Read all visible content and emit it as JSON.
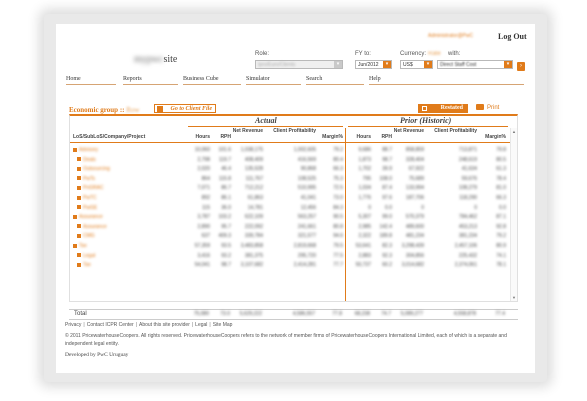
{
  "header": {
    "user_name": "Administrator@PwC",
    "logout_label": "Log Out",
    "site_name_blurred": "mypwc",
    "site_name_suffix": "site"
  },
  "filters": {
    "role_label": "Role:",
    "role_value": "Ipro/Euro/Clients",
    "fy_label": "FY to:",
    "fy_value": "Jun/2012",
    "currency_label": "Currency:",
    "currency_value": "US$",
    "with_blurred": "Rate",
    "with_label": "with:",
    "with_value": "Direct Staff Cost",
    "go_label": "›"
  },
  "menu": {
    "items": [
      "Home",
      "Reports",
      "Business Cube",
      "Simulator",
      "Search",
      "Help"
    ]
  },
  "section": {
    "title": "Economic group :: ",
    "title_blurred": "Row",
    "client_file_button": "Go to Client File",
    "restated_button": "Restated",
    "print_label": "Print"
  },
  "table": {
    "group_actual": "Actual",
    "group_prior": "Prior (Historic)",
    "columns_left": "LoS/SubLoS/Company/Project",
    "columns": [
      "Hours",
      "RPH",
      "Net Revenue",
      "Client Profitability",
      "Margin%",
      "Hours",
      "RPH",
      "Net Revenue",
      "Client Profitability",
      "Margin%"
    ],
    "rows": [
      {
        "name": "Advisory",
        "level": 0,
        "values": [
          "10,060",
          "101.6",
          "1,038,175",
          "1,002,605",
          "79.2",
          "9,686",
          "88.7",
          "858,859",
          "713,871",
          "79.8"
        ]
      },
      {
        "name": "Deals",
        "level": 1,
        "values": [
          "2,798",
          "119.7",
          "408,409",
          "416,569",
          "80.4",
          "1,873",
          "98.7",
          "328,404",
          "248,619",
          "80.5"
        ]
      },
      {
        "name": "Outsourcing",
        "level": 1,
        "values": [
          "2,020",
          "46.4",
          "135,528",
          "90,868",
          "66.3",
          "1,702",
          "39.9",
          "67,922",
          "41,634",
          "61.3"
        ]
      },
      {
        "name": "PwTs",
        "level": 1,
        "values": [
          "864",
          "115.8",
          "111,767",
          "108,525",
          "75.3",
          "795",
          "108.0",
          "75,689",
          "59,676",
          "78.4"
        ]
      },
      {
        "name": "PnGRAC",
        "level": 1,
        "values": [
          "7,071",
          "86.7",
          "712,212",
          "510,995",
          "72.5",
          "1,034",
          "87.4",
          "133,994",
          "108,279",
          "81.0"
        ]
      },
      {
        "name": "PwTC",
        "level": 1,
        "values": [
          "892",
          "86.1",
          "61,863",
          "41,041",
          "73.0",
          "1,776",
          "97.6",
          "187,706",
          "118,290",
          "66.3"
        ]
      },
      {
        "name": "PwGE",
        "level": 1,
        "values": [
          "115",
          "36.0",
          "14,781",
          "12,456",
          "84.3",
          "0",
          "0.0",
          "0",
          "0",
          "0.0"
        ]
      },
      {
        "name": "Assurance",
        "level": 0,
        "values": [
          "3,787",
          "103.2",
          "622,109",
          "563,257",
          "90.5",
          "5,307",
          "99.0",
          "570,379",
          "784,462",
          "87.1"
        ]
      },
      {
        "name": "Assurance",
        "level": 1,
        "values": [
          "2,890",
          "95.7",
          "222,092",
          "241,661",
          "80.8",
          "2,985",
          "142.4",
          "489,600",
          "453,213",
          "92.8"
        ]
      },
      {
        "name": "CMG",
        "level": 1,
        "values": [
          "637",
          "409.3",
          "339,784",
          "321,577",
          "94.6",
          "2,322",
          "189.8",
          "481,234",
          "381,234",
          "79.2"
        ]
      },
      {
        "name": "Tax",
        "level": 0,
        "values": [
          "57,359",
          "93.5",
          "3,483,858",
          "2,819,668",
          "79.5",
          "53,641",
          "82.3",
          "3,298,439",
          "2,457,106",
          "80.9"
        ]
      },
      {
        "name": "Legal",
        "level": 1,
        "values": [
          "3,416",
          "93.2",
          "381,375",
          "295,720",
          "77.5",
          "2,883",
          "92.3",
          "304,856",
          "225,432",
          "74.1"
        ]
      },
      {
        "name": "Tax",
        "level": 1,
        "values": [
          "54,041",
          "98.7",
          "3,107,682",
          "2,414,281",
          "77.7",
          "50,737",
          "60.2",
          "3,014,682",
          "2,374,061",
          "78.1"
        ]
      }
    ],
    "total_label": "Total",
    "total_values": [
      "75,080",
      "73.0",
      "5,629,222",
      "4,586,557",
      "77.8",
      "68,238",
      "74.7",
      "5,089,277",
      "4,558,878",
      "77.4"
    ]
  },
  "footer": {
    "links": [
      "Privacy",
      "Contact ICPR Center",
      "About this site provider",
      "Legal",
      "Site Map"
    ],
    "copyright": "© 2011 PricewaterhouseCoopers. All rights reserved. PricewaterhouseCoopers refers to the network of member firms of PricewaterhouseCoopers International Limited, each of which is a separate and independent legal entity.",
    "developed_by": "Developed by PwC Uruguay"
  },
  "colors": {
    "accent": "#e07b1a",
    "text": "#333333"
  }
}
